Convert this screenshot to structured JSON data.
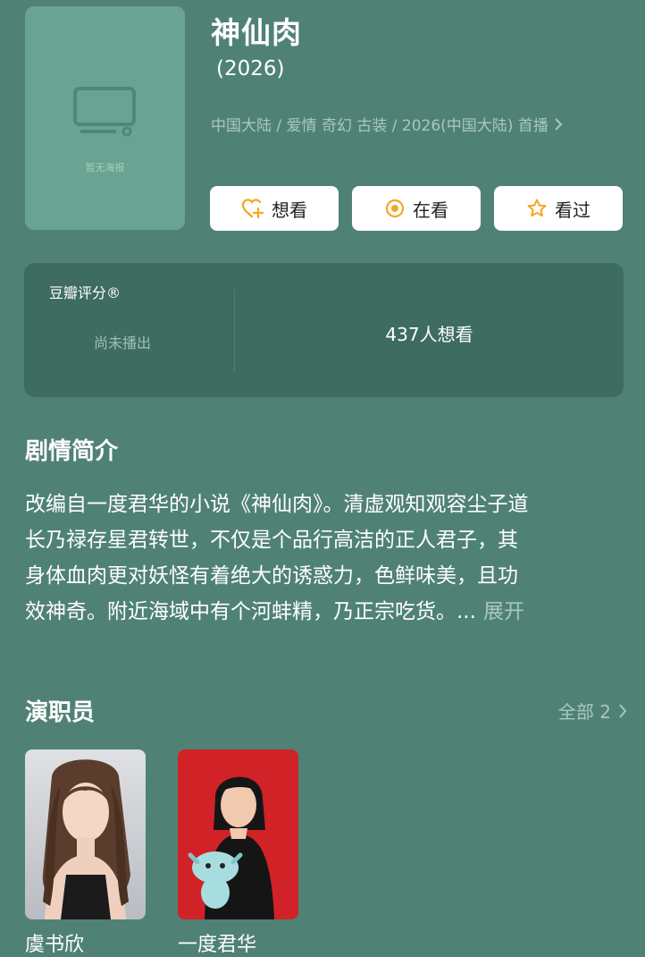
{
  "show": {
    "title": "神仙肉",
    "year": "(2026)",
    "meta": "中国大陆 / 爱情 奇幻 古装 / 2026(中国大陆) 首播",
    "poster_placeholder": "暂无海报"
  },
  "actions": [
    {
      "label": "想看",
      "icon": "heart-plus-icon"
    },
    {
      "label": "在看",
      "icon": "target-icon"
    },
    {
      "label": "看过",
      "icon": "star-icon"
    }
  ],
  "rating": {
    "title": "豆瓣评分®",
    "status": "尚未播出",
    "want_count": "437人想看"
  },
  "synopsis": {
    "heading": "剧情简介",
    "lines": [
      "改编自一度君华的小说《神仙肉》。清虚观知观容尘子道",
      "长乃禄存星君转世，不仅是个品行高洁的正人君子，其",
      "身体血肉更对妖怪有着绝大的诱惑力，色鲜味美，且功",
      "效神奇。附近海域中有个河蚌精，乃正宗吃货。..."
    ],
    "expand_label": "展开"
  },
  "cast": {
    "heading": "演职员",
    "all_label": "全部 2",
    "members": [
      {
        "name": "虞书欣"
      },
      {
        "name": "一度君华"
      }
    ]
  },
  "colors": {
    "background": "#4f8275",
    "panel": "#3e6c60",
    "accent": "#f5a623",
    "muted_text": "#a9c8bd"
  }
}
